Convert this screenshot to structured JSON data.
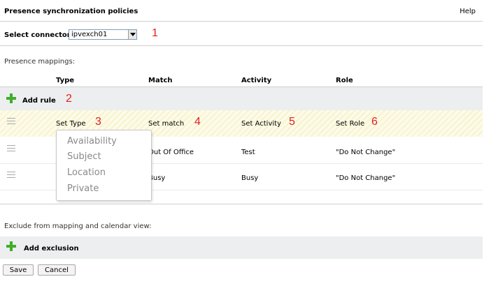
{
  "header": {
    "title": "Presence synchronization policies",
    "help": "Help"
  },
  "connector": {
    "label": "Select connector",
    "value": "ipvexch01",
    "callout": "1"
  },
  "mappings": {
    "label": "Presence mappings:",
    "columns": [
      "Type",
      "Match",
      "Activity",
      "Role"
    ],
    "add_rule": {
      "label": "Add rule",
      "callout": "2"
    },
    "edit_row": {
      "type": "Set Type",
      "type_callout": "3",
      "match": "Set match",
      "match_callout": "4",
      "activity": "Set Activity",
      "activity_callout": "5",
      "role": "Set Role",
      "role_callout": "6"
    },
    "rows": [
      {
        "match": "Out Of Office",
        "activity": "Test",
        "role": "\"Do Not Change\""
      },
      {
        "match": "Busy",
        "activity": "Busy",
        "role": "\"Do Not Change\""
      }
    ],
    "type_options": [
      "Availability",
      "Subject",
      "Location",
      "Private"
    ]
  },
  "exclusions": {
    "label": "Exclude from mapping and calendar view:",
    "add": "Add exclusion"
  },
  "buttons": {
    "save": "Save",
    "cancel": "Cancel"
  },
  "colors": {
    "plus_green": "#3fae29",
    "callout_red": "#e02020",
    "highlight": "#fdfbe8"
  }
}
